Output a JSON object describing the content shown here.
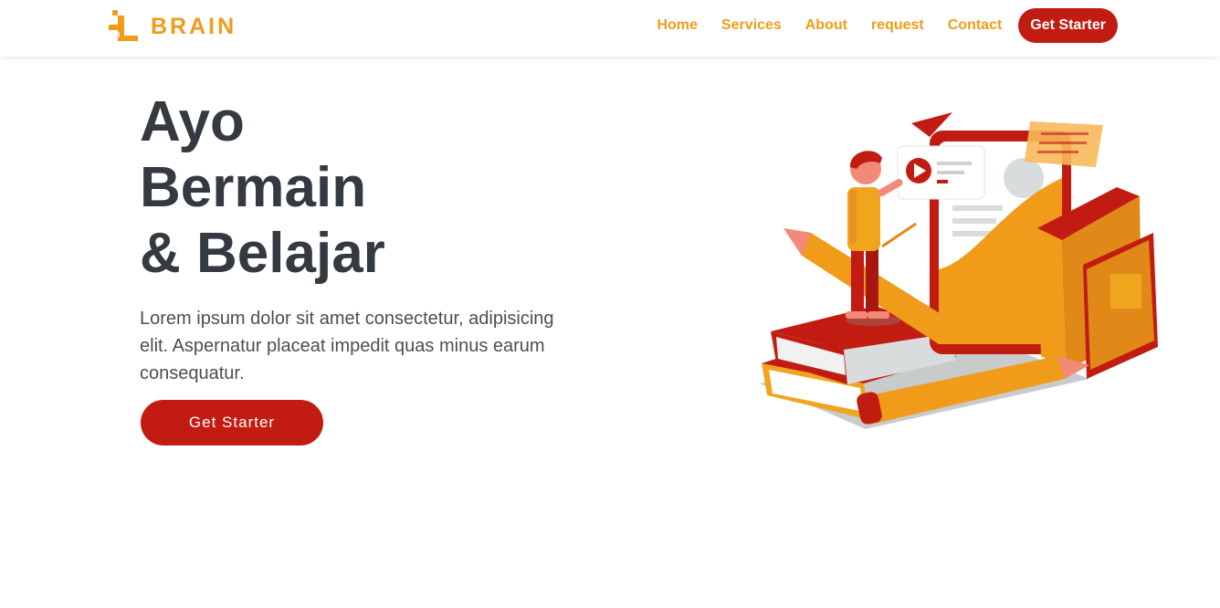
{
  "brand": {
    "name": "BRAIN",
    "logo_icon": "brain-logo-icon",
    "color": "#f09c1a"
  },
  "nav": {
    "items": [
      {
        "label": "Home"
      },
      {
        "label": "Services"
      },
      {
        "label": "About"
      },
      {
        "label": "request"
      },
      {
        "label": "Contact"
      }
    ],
    "cta_label": "Get Starter"
  },
  "hero": {
    "title_lines": [
      "Ayo",
      "Bermain",
      "& Belajar"
    ],
    "description": "Lorem ipsum dolor sit amet consectetur, adipisicing elit. Aspernatur placeat impedit quas minus earum consequatur.",
    "cta_label": "Get Starter",
    "illustration_icon": "education-illustration"
  },
  "colors": {
    "primary_red": "#c21c12",
    "accent_orange": "#f09c1a",
    "heading": "#343a40"
  }
}
